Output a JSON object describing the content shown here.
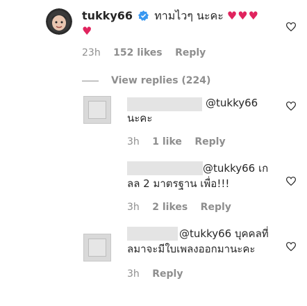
{
  "main_comment": {
    "username": "tukky66",
    "text": "ทามไวๆ นะคะ",
    "hearts": "♥♥♥",
    "second_heart": "♥",
    "time": "23h",
    "likes": "152 likes",
    "reply": "Reply"
  },
  "view_replies": "View replies (224)",
  "replies": [
    {
      "mention": "@tukky66",
      "text": "นะคะ",
      "time": "3h",
      "likes": "1 like",
      "reply": "Reply"
    },
    {
      "mention": "@tukky66",
      "text": "เก",
      "text2": "ลล 2 มาตรฐาน เพื่อ!!!",
      "time": "3h",
      "likes": "2 likes",
      "reply": "Reply"
    },
    {
      "mention": "@tukky66",
      "text": "บุคคลที่",
      "text2": "ลมาจะมีใบเพลงออกมานะคะ",
      "time": "3h",
      "reply": "Reply"
    }
  ],
  "colors": {
    "heart_red": "#e0245e",
    "verified_blue": "#3897f0",
    "meta_gray": "#8e8e8e"
  }
}
